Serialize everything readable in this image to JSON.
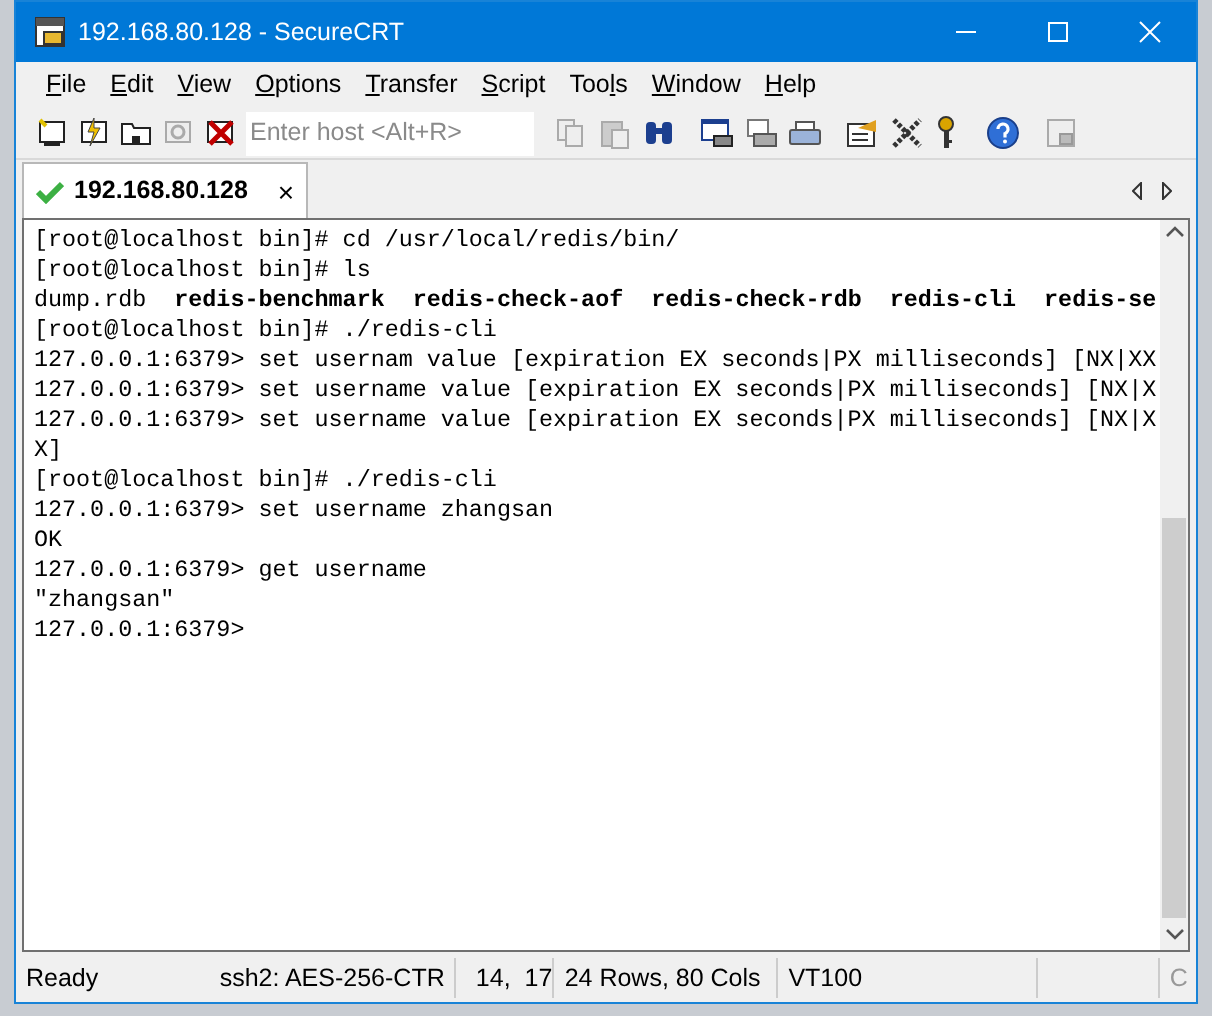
{
  "window": {
    "title": "192.168.80.128 - SecureCRT"
  },
  "menu": [
    {
      "mnemonic": "F",
      "rest": "ile"
    },
    {
      "mnemonic": "E",
      "rest": "dit"
    },
    {
      "mnemonic": "V",
      "rest": "iew"
    },
    {
      "mnemonic": "O",
      "rest": "ptions"
    },
    {
      "mnemonic": "T",
      "rest": "ransfer"
    },
    {
      "mnemonic": "S",
      "rest": "cript"
    },
    {
      "lead": "Too",
      "mnemonic": "l",
      "rest": "s"
    },
    {
      "mnemonic": "W",
      "rest": "indow"
    },
    {
      "mnemonic": "H",
      "rest": "elp"
    }
  ],
  "toolbar": {
    "host_field": {
      "placeholder": "Enter host <Alt+R>"
    }
  },
  "tabs": [
    {
      "label": "192.168.80.128",
      "selected": true,
      "close": "×"
    }
  ],
  "terminal": {
    "lines": [
      "[root@localhost bin]# cd /usr/local/redis/bin/",
      "[root@localhost bin]# ls",
      "dump.rdb  **redis-benchmark**  **redis-check-aof**  **redis-check-rdb**  **redis-cli**  **redis-se**",
      "[root@localhost bin]# ./redis-cli",
      "127.0.0.1:6379> set usernam value [expiration EX seconds|PX milliseconds] [NX|XX",
      "127.0.0.1:6379> set username value [expiration EX seconds|PX milliseconds] [NX|X",
      "127.0.0.1:6379> set username value [expiration EX seconds|PX milliseconds] [NX|X",
      "X]",
      "[root@localhost bin]# ./redis-cli",
      "127.0.0.1:6379> set username zhangsan",
      "OK",
      "127.0.0.1:6379> get username",
      "\"zhangsan\"",
      "127.0.0.1:6379>"
    ]
  },
  "status_bar": [
    "Ready",
    "ssh2: AES-256-CTR",
    "14,  17",
    "24 Rows, 80 Cols",
    "VT100",
    "C"
  ]
}
